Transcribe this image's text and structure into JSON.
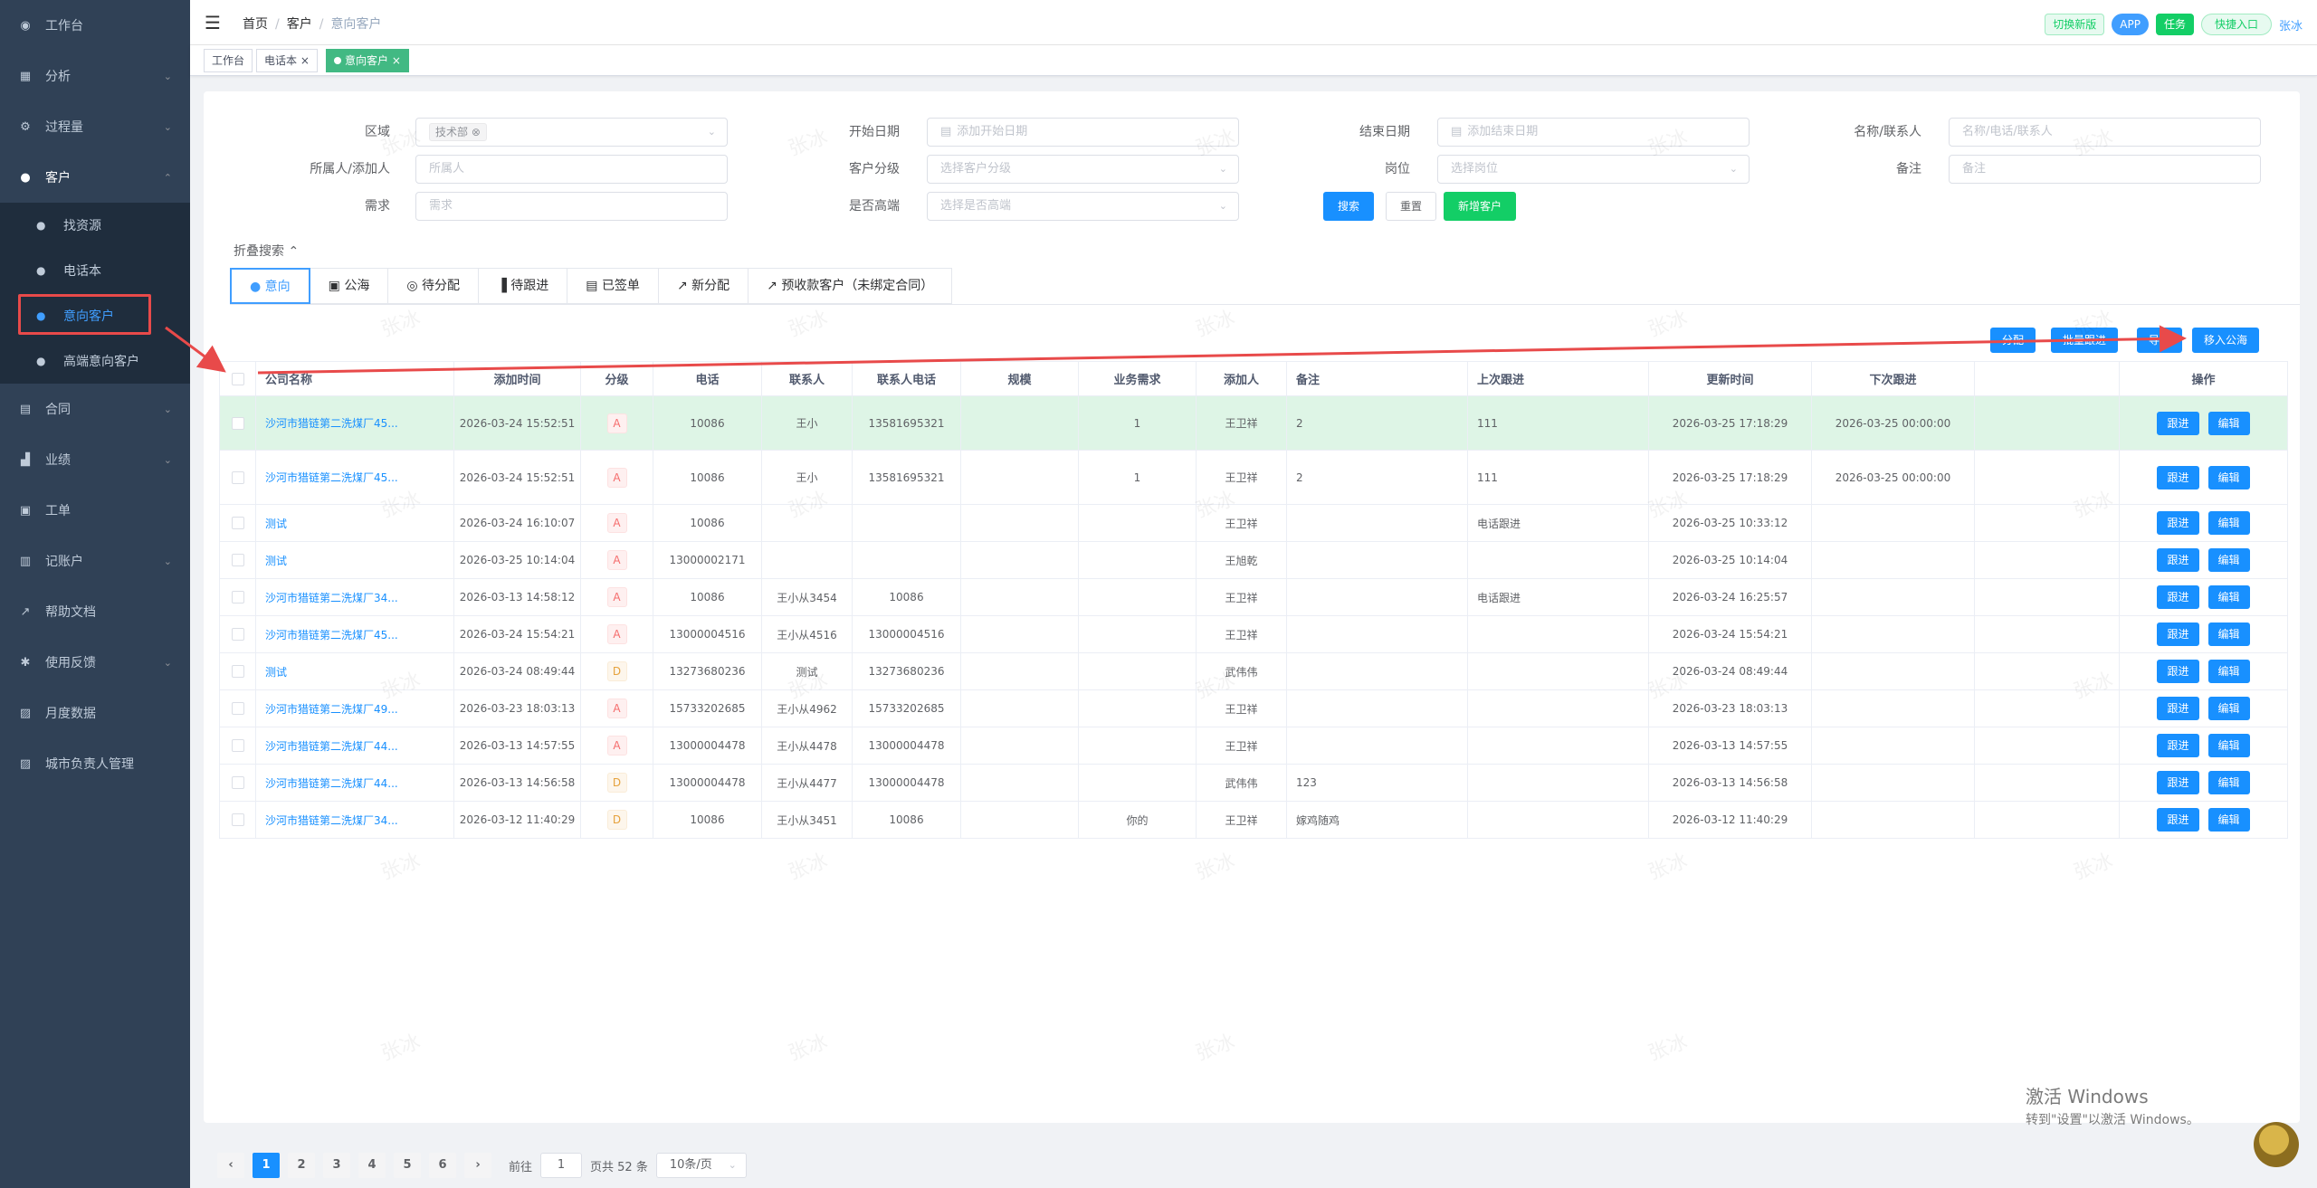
{
  "sidebar": {
    "menu": [
      {
        "label": "工作台",
        "icon": "dashboard-icon",
        "arrow": false
      },
      {
        "label": "分析",
        "icon": "chart-icon",
        "arrow": true
      },
      {
        "label": "过程量",
        "icon": "process-icon",
        "arrow": true
      },
      {
        "label": "客户",
        "icon": "user-icon",
        "arrow": true
      },
      {
        "label": "合同",
        "icon": "contract-icon",
        "arrow": true
      },
      {
        "label": "业绩",
        "icon": "performance-icon",
        "arrow": true
      },
      {
        "label": "工单",
        "icon": "order-icon",
        "arrow": false
      },
      {
        "label": "记账户",
        "icon": "account-icon",
        "arrow": true
      },
      {
        "label": "帮助文档",
        "icon": "help-icon",
        "arrow": false
      },
      {
        "label": "使用反馈",
        "icon": "bug-icon",
        "arrow": true
      },
      {
        "label": "月度数据",
        "icon": "month-data-icon",
        "arrow": false
      },
      {
        "label": "城市负责人管理",
        "icon": "city-manager-icon",
        "arrow": false
      }
    ],
    "customer_sub": [
      {
        "label": "找资源"
      },
      {
        "label": "电话本"
      },
      {
        "label": "意向客户"
      },
      {
        "label": "高端意向客户"
      }
    ]
  },
  "navbar": {
    "breadcrumb": [
      "首页",
      "客户",
      "意向客户"
    ],
    "switch_label": "切换新版",
    "app_label": "APP",
    "task_label": "任务",
    "quick_label": "快捷入口",
    "user_name": "张冰"
  },
  "tags": [
    {
      "label": "工作台"
    },
    {
      "label": "电话本"
    },
    {
      "label": "意向客户"
    }
  ],
  "filters": {
    "region_label": "区域",
    "region_chip": "技术部",
    "start_label": "开始日期",
    "start_placeholder": "添加开始日期",
    "end_label": "结束日期",
    "end_placeholder": "添加结束日期",
    "name_label": "名称/联系人",
    "name_placeholder": "名称/电话/联系人",
    "owner_label": "所属人/添加人",
    "owner_placeholder": "所属人",
    "grade_label": "客户分级",
    "grade_placeholder": "选择客户分级",
    "post_label": "岗位",
    "post_placeholder": "选择岗位",
    "remark_label": "备注",
    "remark_placeholder": "备注",
    "need_label": "需求",
    "need_placeholder": "需求",
    "highend_label": "是否高端",
    "highend_placeholder": "选择是否高端",
    "search_btn": "搜索",
    "reset_btn": "重置",
    "add_btn": "新增客户",
    "collapse_label": "折叠搜索"
  },
  "tabs": [
    "意向",
    "公海",
    "待分配",
    "待跟进",
    "已签单",
    "新分配",
    "预收款客户（未绑定合同）"
  ],
  "action_buttons": [
    "分配",
    "批量跟进",
    "导出",
    "移入公海"
  ],
  "table": {
    "headers": [
      "公司名称",
      "添加时间",
      "分级",
      "电话",
      "联系人",
      "联系人电话",
      "规模",
      "业务需求",
      "添加人",
      "备注",
      "上次跟进",
      "更新时间",
      "下次跟进",
      "",
      "操作"
    ],
    "follow_label": "跟进",
    "edit_label": "编辑",
    "rows": [
      [
        "沙河市猎链第二洗煤厂45...",
        "2026-03-24 15:52:51",
        "A",
        "10086",
        "王小",
        "13581695321",
        "",
        "1",
        "王卫祥",
        "2",
        "111",
        "2026-03-25 17:18:29",
        "2026-03-25 00:00:00",
        ""
      ],
      [
        "沙河市猎链第二洗煤厂45...",
        "2026-03-24 15:52:51",
        "A",
        "10086",
        "王小",
        "13581695321",
        "",
        "1",
        "王卫祥",
        "2",
        "111",
        "2026-03-25 17:18:29",
        "2026-03-25 00:00:00",
        ""
      ],
      [
        "测试",
        "2026-03-24 16:10:07",
        "A",
        "10086",
        "",
        "",
        "",
        "",
        "王卫祥",
        "",
        "电话跟进",
        "2026-03-25 10:33:12",
        "",
        ""
      ],
      [
        "测试",
        "2026-03-25 10:14:04",
        "A",
        "13000002171",
        "",
        "",
        "",
        "",
        "王旭乾",
        "",
        "",
        "2026-03-25 10:14:04",
        "",
        ""
      ],
      [
        "沙河市猎链第二洗煤厂34...",
        "2026-03-13 14:58:12",
        "A",
        "10086",
        "王小从3454",
        "10086",
        "",
        "",
        "王卫祥",
        "",
        "电话跟进",
        "2026-03-24 16:25:57",
        "",
        ""
      ],
      [
        "沙河市猎链第二洗煤厂45...",
        "2026-03-24 15:54:21",
        "A",
        "13000004516",
        "王小从4516",
        "13000004516",
        "",
        "",
        "王卫祥",
        "",
        "",
        "2026-03-24 15:54:21",
        "",
        ""
      ],
      [
        "测试",
        "2026-03-24 08:49:44",
        "D",
        "13273680236",
        "测试",
        "13273680236",
        "",
        "",
        "武伟伟",
        "",
        "",
        "2026-03-24 08:49:44",
        "",
        ""
      ],
      [
        "沙河市猎链第二洗煤厂49...",
        "2026-03-23 18:03:13",
        "A",
        "15733202685",
        "王小从4962",
        "15733202685",
        "",
        "",
        "王卫祥",
        "",
        "",
        "2026-03-23 18:03:13",
        "",
        ""
      ],
      [
        "沙河市猎链第二洗煤厂44...",
        "2026-03-13 14:57:55",
        "A",
        "13000004478",
        "王小从4478",
        "13000004478",
        "",
        "",
        "王卫祥",
        "",
        "",
        "2026-03-13 14:57:55",
        "",
        ""
      ],
      [
        "沙河市猎链第二洗煤厂44...",
        "2026-03-13 14:56:58",
        "D",
        "13000004478",
        "王小从4477",
        "13000004478",
        "",
        "",
        "武伟伟",
        "123",
        "",
        "2026-03-13 14:56:58",
        "",
        ""
      ],
      [
        "沙河市猎链第二洗煤厂34...",
        "2026-03-12 11:40:29",
        "D",
        "10086",
        "王小从3451",
        "10086",
        "",
        "你的",
        "王卫祥",
        "嫁鸡随鸡",
        "",
        "2026-03-12 11:40:29",
        "",
        ""
      ]
    ]
  },
  "pagination": {
    "pages": [
      "1",
      "2",
      "3",
      "4",
      "5",
      "6"
    ],
    "prev": "‹",
    "next": "›",
    "goto_label": "前往",
    "goto_value": "1",
    "total_label": "页共 52 条",
    "size_label": "10条/页"
  },
  "watermark": "张冰",
  "windows_activation": {
    "title": "激活 Windows",
    "subtitle": "转到\"设置\"以激活 Windows。"
  },
  "colors": {
    "sidebar_bg": "#304156",
    "primary": "#1890ff",
    "success": "#13ce66",
    "highlight_row": "#def5e6",
    "annotation_red": "#e84a4a"
  }
}
